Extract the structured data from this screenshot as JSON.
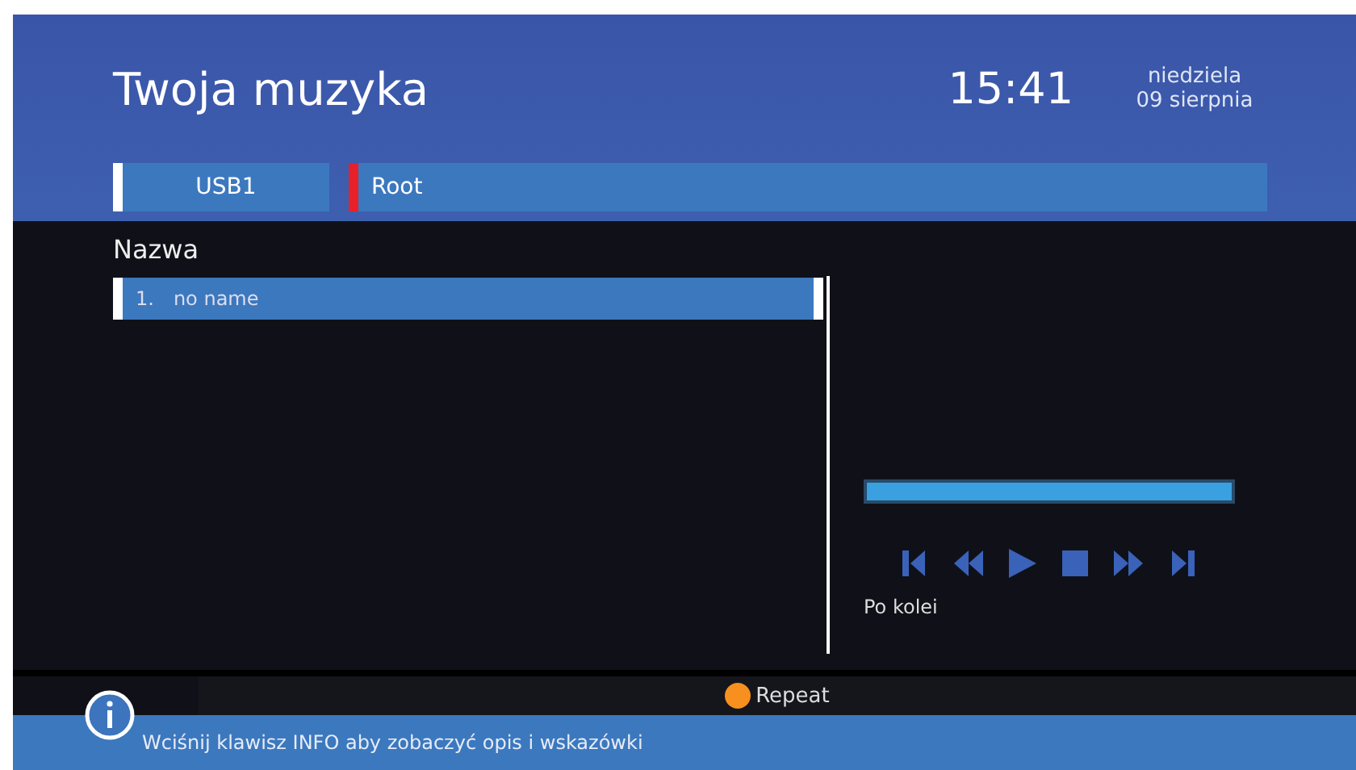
{
  "header": {
    "title": "Twoja muzyka",
    "time": "15:41",
    "day": "niedziela",
    "date": "09 sierpnia"
  },
  "path": [
    {
      "label": "USB1",
      "color": "#ffffff"
    },
    {
      "label": "Root",
      "color": "#e8202a"
    }
  ],
  "list": {
    "heading": "Nazwa",
    "items": [
      {
        "number": "1.",
        "name": "no name",
        "selected": true
      }
    ]
  },
  "player": {
    "level": 1,
    "controls": [
      {
        "kind": "prev"
      },
      {
        "kind": "rewind"
      },
      {
        "kind": "play"
      },
      {
        "kind": "stop"
      },
      {
        "kind": "forward"
      },
      {
        "kind": "next"
      }
    ],
    "mode": "Po kolei"
  },
  "footer": {
    "repeat": {
      "label": "Repeat",
      "color": "#f7901e"
    },
    "hint": "Wciśnij klawisz INFO aby zobaczyć opis i wskazówki"
  }
}
